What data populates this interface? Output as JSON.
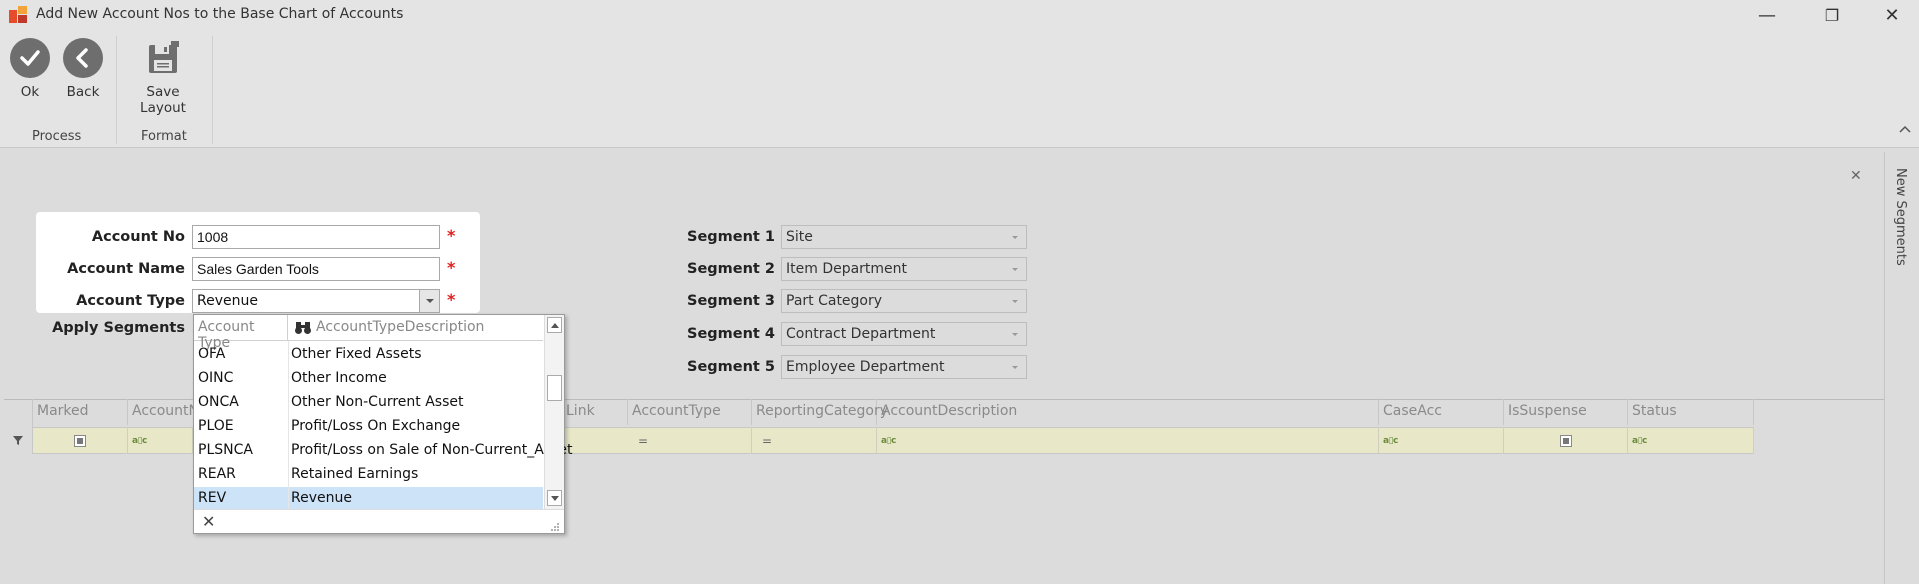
{
  "window": {
    "title": "Add New Account Nos to the Base Chart of Accounts",
    "minimize": "—",
    "restore": "❐",
    "close": "✕"
  },
  "ribbon": {
    "ok_label": "Ok",
    "back_label": "Back",
    "save_layout_label": "Save Layout",
    "group_process": "Process",
    "group_format": "Format",
    "collapse_glyph": "^"
  },
  "form": {
    "account_no_label": "Account No",
    "account_no_value": "1008",
    "account_name_label": "Account Name",
    "account_name_value": "Sales Garden Tools",
    "account_type_label": "Account Type",
    "account_type_value": "Revenue",
    "apply_segments_label": "Apply Segments",
    "required_marker": "*"
  },
  "segments": [
    {
      "label": "Segment 1",
      "value": "Site"
    },
    {
      "label": "Segment 2",
      "value": "Item Department"
    },
    {
      "label": "Segment 3",
      "value": "Part Category"
    },
    {
      "label": "Segment 4",
      "value": "Contract Department"
    },
    {
      "label": "Segment 5",
      "value": "Employee Department"
    }
  ],
  "dropdown": {
    "col_code": "Account Type",
    "col_desc": "AccountTypeDescription",
    "rows": [
      {
        "code": "OFA",
        "desc": "Other Fixed Assets"
      },
      {
        "code": "OINC",
        "desc": "Other Income"
      },
      {
        "code": "ONCA",
        "desc": "Other Non-Current Asset"
      },
      {
        "code": "PLOE",
        "desc": "Profit/Loss On Exchange"
      },
      {
        "code": "PLSNCA",
        "desc": "Profit/Loss on Sale of Non-Current_Asset"
      },
      {
        "code": "REAR",
        "desc": "Retained Earnings"
      },
      {
        "code": "REV",
        "desc": "Revenue"
      }
    ],
    "selected_code": "REV"
  },
  "grid": {
    "columns": [
      "Marked",
      "AccountNu",
      "Link",
      "AccountType",
      "ReportingCategory",
      "AccountDescription",
      "CaseAcc",
      "IsSuspense",
      "Status"
    ],
    "filter_equals": "="
  },
  "side_panel": {
    "label": "New Segments",
    "close_glyph": "✕"
  },
  "colors": {
    "required": "#e02020",
    "selection": "#cde3f7",
    "filter_row": "#e8e8c9"
  }
}
